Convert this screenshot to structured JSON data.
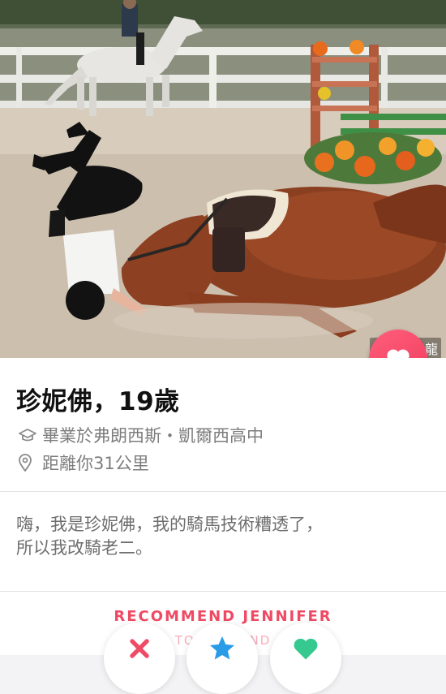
{
  "profile": {
    "name_age": "珍妮佛，19歲",
    "school": "畢業於弗朗西斯・凱爾西高中",
    "distance": "距離你31公里",
    "bio_lines": [
      "嗨，我是珍妮佛，我的騎馬技術糟透了，",
      "所以我改騎老二。"
    ]
  },
  "photo": {
    "watermark": "譯：好色龍"
  },
  "recommend": {
    "title": "RECOMMEND JENNIFER",
    "subtitle": "TO A FRIEND"
  },
  "colors": {
    "accent": "#ef4a66",
    "star": "#2a9be6",
    "heart_green": "#36c98f"
  },
  "icons": {
    "like": "heart-icon",
    "school": "graduation-cap-icon",
    "distance": "location-pin-icon",
    "nope": "x-icon",
    "super_like": "star-icon",
    "like_small": "heart-icon"
  }
}
